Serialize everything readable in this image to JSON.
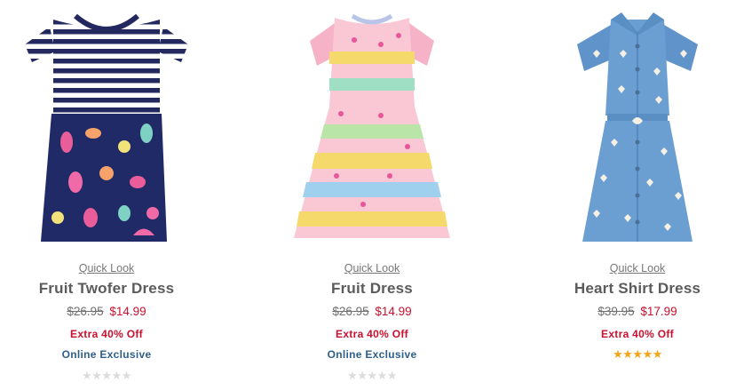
{
  "products": [
    {
      "quick_look": "Quick Look",
      "name": "Fruit Twofer Dress",
      "original_price": "$26.95",
      "sale_price": "$14.99",
      "promo": "Extra 40% Off",
      "exclusive": "Online Exclusive",
      "rating_stars": "★★★★★",
      "rating_filled": 0
    },
    {
      "quick_look": "Quick Look",
      "name": "Fruit Dress",
      "original_price": "$26.95",
      "sale_price": "$14.99",
      "promo": "Extra 40% Off",
      "exclusive": "Online Exclusive",
      "rating_stars": "★★★★★",
      "rating_filled": 0
    },
    {
      "quick_look": "Quick Look",
      "name": "Heart Shirt Dress",
      "original_price": "$39.95",
      "sale_price": "$17.99",
      "promo": "Extra 40% Off",
      "rating_stars": "★★★★★",
      "rating_filled": 5
    }
  ],
  "colors": {
    "sale": "#c8102e",
    "exclusive": "#2e5f8c",
    "star_active": "#f2a51a",
    "star_inactive": "#dcdcdc"
  }
}
